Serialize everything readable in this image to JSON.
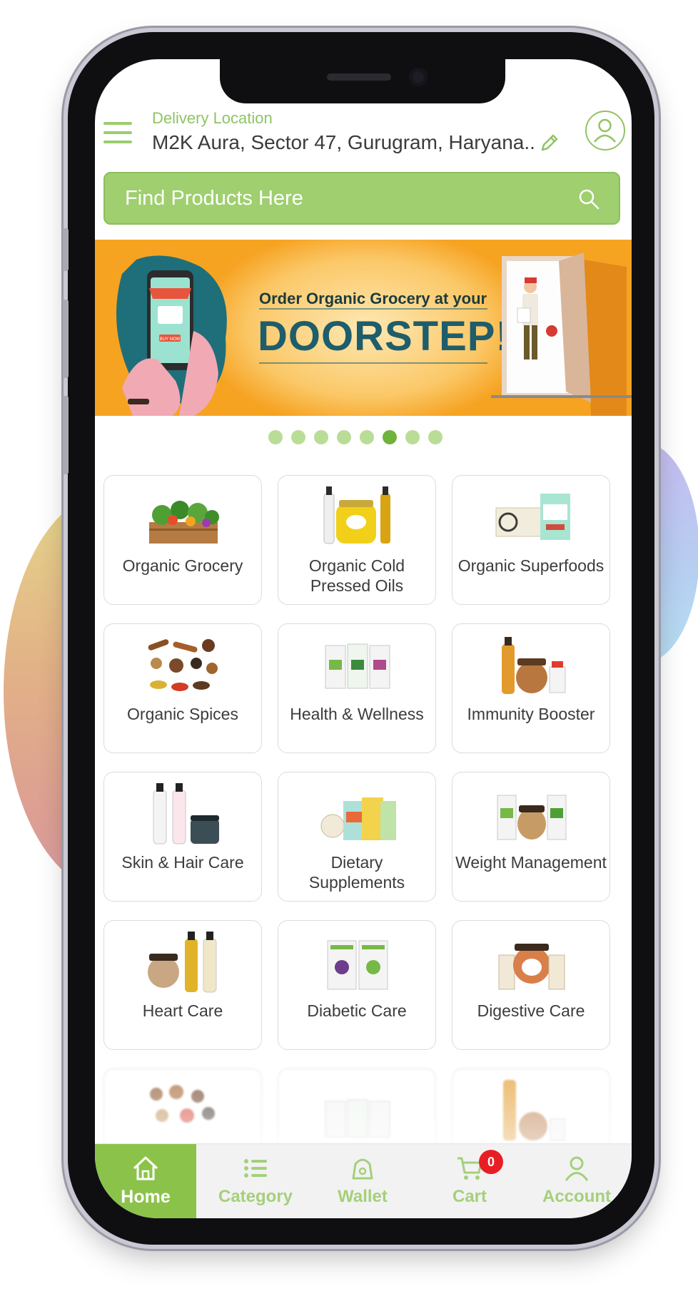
{
  "header": {
    "location_label": "Delivery Location",
    "location_value": "M2K Aura, Sector 47, Gurugram, Haryana..."
  },
  "search": {
    "placeholder": "Find Products Here"
  },
  "banner": {
    "subtitle": "Order Organic Grocery at your",
    "headline": "DOORSTEP!",
    "phone_button": "BUY NOW"
  },
  "carousel": {
    "total": 8,
    "active_index": 5
  },
  "categories": [
    {
      "label": "Organic Grocery",
      "icon": "vegetable-crate-image"
    },
    {
      "label": "Organic Cold Pressed Oils",
      "icon": "oil-bottles-image"
    },
    {
      "label": "Organic Superfoods",
      "icon": "quinoa-flaxseed-box-image"
    },
    {
      "label": "Organic Spices",
      "icon": "spices-image"
    },
    {
      "label": "Health & Wellness",
      "icon": "wellness-boxes-image"
    },
    {
      "label": "Immunity Booster",
      "icon": "immunity-products-image"
    },
    {
      "label": "Skin & Hair Care",
      "icon": "skin-hair-bottles-image"
    },
    {
      "label": "Dietary Supplements",
      "icon": "supplement-packs-image"
    },
    {
      "label": "Weight Management",
      "icon": "weight-management-image"
    },
    {
      "label": "Heart Care",
      "icon": "heart-care-products-image"
    },
    {
      "label": "Diabetic Care",
      "icon": "diabetic-care-boxes-image"
    },
    {
      "label": "Digestive Care",
      "icon": "digestive-care-jar-image"
    }
  ],
  "bottom_nav": [
    {
      "label": "Home",
      "icon": "home-icon",
      "active": true
    },
    {
      "label": "Category",
      "icon": "list-icon"
    },
    {
      "label": "Wallet",
      "icon": "wallet-icon"
    },
    {
      "label": "Cart",
      "icon": "cart-icon",
      "badge": "0"
    },
    {
      "label": "Account",
      "icon": "user-icon"
    }
  ],
  "colors": {
    "brand_green": "#8bc34a",
    "search_green": "#9fcf6e",
    "banner_orange": "#f6a322",
    "badge_red": "#e81e25"
  }
}
